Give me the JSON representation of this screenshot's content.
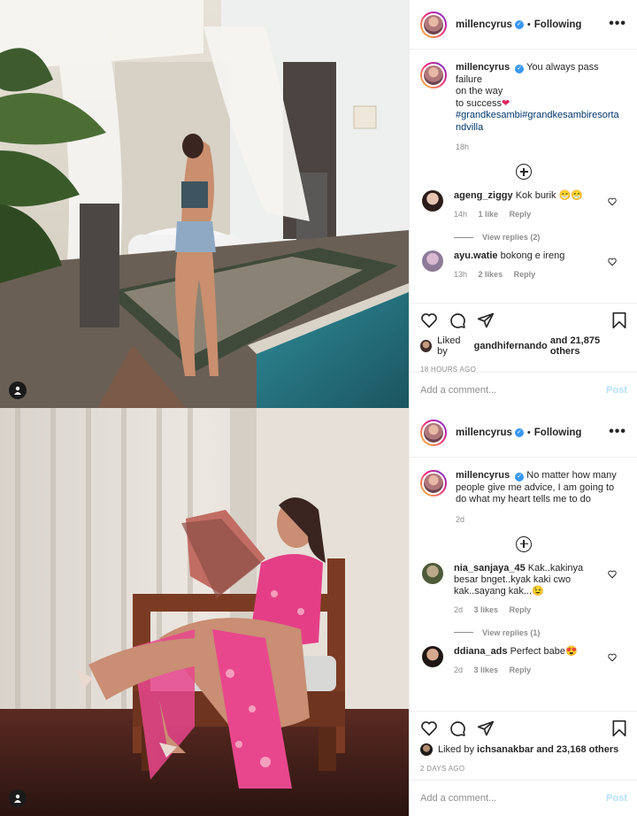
{
  "posts": [
    {
      "username": "millencyrus",
      "follow_label": "Following",
      "more_label": "•••",
      "caption": {
        "username": "millencyrus",
        "text_1": "You always pass failure",
        "text_2": "on the way",
        "text_3": "to success",
        "emoji": "❤",
        "hashtags": "#grandkesambi#grandkesambiresortandvilla",
        "time": "18h"
      },
      "comments": [
        {
          "username": "ageng_ziggy",
          "text": "Kok burik 😁😁",
          "time": "14h",
          "likes": "1 like",
          "reply": "Reply"
        },
        {
          "username": "ayu.watie",
          "text": "bokong e ireng",
          "time": "13h",
          "likes": "2 likes",
          "reply": "Reply"
        }
      ],
      "view_replies": "View replies (2)",
      "liked_by_prefix": "Liked by",
      "liked_by_user": "gandhifernando",
      "liked_by_suffix": "and 21,875 others",
      "ago": "18 HOURS AGO",
      "add_comment_placeholder": "Add a comment...",
      "post_label": "Post"
    },
    {
      "username": "millencyrus",
      "follow_label": "Following",
      "more_label": "•••",
      "caption": {
        "username": "millencyrus",
        "text_1": "No matter how many people give me advice, I am going to do what my heart tells me to do",
        "time": "2d"
      },
      "comments": [
        {
          "username": "nia_sanjaya_45",
          "text": "Kak..kakinya besar bnget..kyak kaki cwo kak..sayang kak...😉",
          "time": "2d",
          "likes": "3 likes",
          "reply": "Reply"
        },
        {
          "username": "ddiana_ads",
          "text": "Perfect babe😍",
          "time": "2d",
          "likes": "3 likes",
          "reply": "Reply"
        }
      ],
      "view_replies": "View replies (1)",
      "liked_by_prefix": "Liked by",
      "liked_by_user": "ichsanakbar",
      "liked_by_suffix": "and 23,168 others",
      "ago": "2 DAYS AGO",
      "add_comment_placeholder": "Add a comment...",
      "post_label": "Post"
    }
  ],
  "colors": {
    "verified": "#3897f0",
    "hashtag": "#00376b",
    "muted": "#8e8e8e",
    "post_disabled": "#b2dffc"
  }
}
